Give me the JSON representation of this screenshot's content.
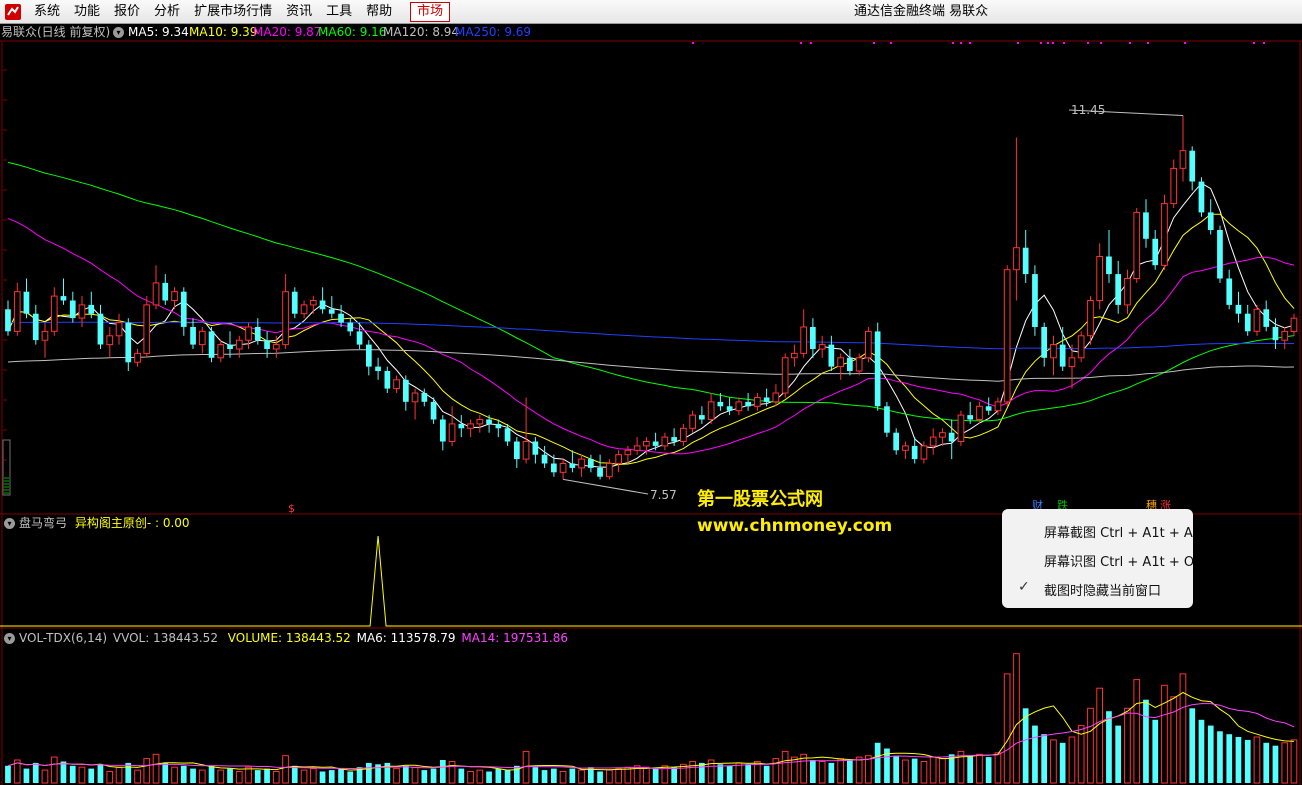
{
  "menubar": {
    "items": [
      "系统",
      "功能",
      "报价",
      "分析",
      "扩展市场行情",
      "资讯",
      "工具",
      "帮助"
    ],
    "market_tab": "市场",
    "app_title": "通达信金融终端  易联众"
  },
  "main_chart": {
    "stock_name": "易联众(日线 前复权)",
    "indicators": [
      {
        "label": "MA5: 9.34",
        "color": "#ffffff"
      },
      {
        "label": "MA10: 9.39",
        "color": "#ffff00"
      },
      {
        "label": "MA20: 9.87",
        "color": "#ff00ff"
      },
      {
        "label": "MA60: 9.16",
        "color": "#00ff00"
      },
      {
        "label": "MA120: 8.94",
        "color": "#c0c0c0"
      },
      {
        "label": "MA250: 9.69",
        "color": "#2040ff"
      }
    ],
    "high_label": "11.45",
    "low_label": "7.57",
    "dollar_marker": "$",
    "markers": [
      "财",
      "跌",
      "穗",
      "涨"
    ]
  },
  "sub_panel": {
    "name": "盘马弯弓",
    "formula": "异构阁主原创- : 0.00"
  },
  "vol_panel": {
    "name": "VOL-TDX(6,14)",
    "values": [
      {
        "label": "VVOL: 138443.52",
        "color": "#c0c0c0"
      },
      {
        "label": "VOLUME: 138443.52",
        "color": "#ffff00"
      },
      {
        "label": "MA6: 113578.79",
        "color": "#ffffff"
      },
      {
        "label": "MA14: 197531.86",
        "color": "#ff40ff"
      }
    ]
  },
  "watermark": {
    "line1": "第一股票公式网",
    "line2": "www.chnmoney.com"
  },
  "context_menu": {
    "items": [
      "屏幕截图 Ctrl + A1t + A",
      "屏幕识图 Ctrl + A1t + O",
      "截图时隐藏当前窗口"
    ],
    "check_mark": "✓"
  },
  "colors": {
    "up": "#ff3232",
    "down": "#54ffff",
    "background": "#000000",
    "grid": "#800000"
  },
  "chart_data": {
    "type": "candlestick",
    "ohlc": [
      [
        9.5,
        9.6,
        9.2,
        9.25
      ],
      [
        9.25,
        9.8,
        9.2,
        9.7
      ],
      [
        9.7,
        9.85,
        9.4,
        9.45
      ],
      [
        9.45,
        9.55,
        9.1,
        9.15
      ],
      [
        9.15,
        9.35,
        8.95,
        9.25
      ],
      [
        9.25,
        9.75,
        9.2,
        9.65
      ],
      [
        9.65,
        9.85,
        9.55,
        9.6
      ],
      [
        9.6,
        9.7,
        9.35,
        9.4
      ],
      [
        9.4,
        9.65,
        9.3,
        9.55
      ],
      [
        9.55,
        9.7,
        9.4,
        9.45
      ],
      [
        9.45,
        9.55,
        9.05,
        9.1
      ],
      [
        9.1,
        9.3,
        8.95,
        9.2
      ],
      [
        9.2,
        9.45,
        9.1,
        9.35
      ],
      [
        9.35,
        9.4,
        8.8,
        8.9
      ],
      [
        8.9,
        9.05,
        8.85,
        9.0
      ],
      [
        9.0,
        9.65,
        8.95,
        9.55
      ],
      [
        9.55,
        10.0,
        9.5,
        9.8
      ],
      [
        9.8,
        9.9,
        9.55,
        9.6
      ],
      [
        9.6,
        9.75,
        9.5,
        9.7
      ],
      [
        9.7,
        9.75,
        9.2,
        9.3
      ],
      [
        9.3,
        9.4,
        9.05,
        9.1
      ],
      [
        9.1,
        9.3,
        9.0,
        9.25
      ],
      [
        9.25,
        9.3,
        8.9,
        8.95
      ],
      [
        8.95,
        9.15,
        8.9,
        9.1
      ],
      [
        9.1,
        9.25,
        8.95,
        9.05
      ],
      [
        9.05,
        9.2,
        8.95,
        9.15
      ],
      [
        9.15,
        9.35,
        9.05,
        9.3
      ],
      [
        9.3,
        9.4,
        9.1,
        9.15
      ],
      [
        9.15,
        9.25,
        8.95,
        9.05
      ],
      [
        9.05,
        9.2,
        8.95,
        9.1
      ],
      [
        9.1,
        9.9,
        9.05,
        9.7
      ],
      [
        9.7,
        9.75,
        9.4,
        9.45
      ],
      [
        9.45,
        9.6,
        9.4,
        9.55
      ],
      [
        9.55,
        9.65,
        9.45,
        9.6
      ],
      [
        9.6,
        9.75,
        9.45,
        9.5
      ],
      [
        9.5,
        9.65,
        9.4,
        9.45
      ],
      [
        9.45,
        9.55,
        9.3,
        9.35
      ],
      [
        9.35,
        9.4,
        9.2,
        9.25
      ],
      [
        9.25,
        9.35,
        9.05,
        9.1
      ],
      [
        9.1,
        9.15,
        8.75,
        8.85
      ],
      [
        8.85,
        8.95,
        8.7,
        8.8
      ],
      [
        8.8,
        8.85,
        8.55,
        8.6
      ],
      [
        8.6,
        8.75,
        8.55,
        8.7
      ],
      [
        8.7,
        8.75,
        8.35,
        8.45
      ],
      [
        8.45,
        8.6,
        8.25,
        8.55
      ],
      [
        8.55,
        8.6,
        8.4,
        8.45
      ],
      [
        8.45,
        8.5,
        8.2,
        8.25
      ],
      [
        8.25,
        8.3,
        7.9,
        8.0
      ],
      [
        8.0,
        8.4,
        7.95,
        8.2
      ],
      [
        8.2,
        8.3,
        8.05,
        8.15
      ],
      [
        8.15,
        8.25,
        8.05,
        8.2
      ],
      [
        8.2,
        8.3,
        8.1,
        8.25
      ],
      [
        8.25,
        8.3,
        8.1,
        8.2
      ],
      [
        8.2,
        8.25,
        8.05,
        8.15
      ],
      [
        8.15,
        8.2,
        7.95,
        8.0
      ],
      [
        8.0,
        8.05,
        7.7,
        7.8
      ],
      [
        7.8,
        8.5,
        7.75,
        8.0
      ],
      [
        8.0,
        8.05,
        7.75,
        7.85
      ],
      [
        7.85,
        7.95,
        7.7,
        7.75
      ],
      [
        7.75,
        7.85,
        7.6,
        7.65
      ],
      [
        7.65,
        7.8,
        7.57,
        7.75
      ],
      [
        7.75,
        7.9,
        7.65,
        7.7
      ],
      [
        7.7,
        7.85,
        7.6,
        7.8
      ],
      [
        7.8,
        7.85,
        7.65,
        7.7
      ],
      [
        7.7,
        7.85,
        7.57,
        7.6
      ],
      [
        7.6,
        7.8,
        7.57,
        7.75
      ],
      [
        7.75,
        7.9,
        7.65,
        7.85
      ],
      [
        7.85,
        7.95,
        7.75,
        7.9
      ],
      [
        7.9,
        8.05,
        7.85,
        7.95
      ],
      [
        7.95,
        8.05,
        7.85,
        8.0
      ],
      [
        8.0,
        8.1,
        7.9,
        7.95
      ],
      [
        7.95,
        8.1,
        7.9,
        8.05
      ],
      [
        8.05,
        8.15,
        7.95,
        8.0
      ],
      [
        8.0,
        8.2,
        7.95,
        8.15
      ],
      [
        8.15,
        8.35,
        8.1,
        8.3
      ],
      [
        8.3,
        8.4,
        8.2,
        8.25
      ],
      [
        8.25,
        8.55,
        8.2,
        8.45
      ],
      [
        8.45,
        8.55,
        8.35,
        8.4
      ],
      [
        8.4,
        8.5,
        8.3,
        8.35
      ],
      [
        8.35,
        8.5,
        8.3,
        8.45
      ],
      [
        8.45,
        8.55,
        8.35,
        8.4
      ],
      [
        8.4,
        8.55,
        8.35,
        8.5
      ],
      [
        8.5,
        8.6,
        8.4,
        8.45
      ],
      [
        8.45,
        8.65,
        8.4,
        8.55
      ],
      [
        8.55,
        9.0,
        8.5,
        8.95
      ],
      [
        8.95,
        9.1,
        8.85,
        9.0
      ],
      [
        9.0,
        9.5,
        8.95,
        9.3
      ],
      [
        9.3,
        9.4,
        8.95,
        9.05
      ],
      [
        9.05,
        9.2,
        8.95,
        9.1
      ],
      [
        9.1,
        9.2,
        8.8,
        8.85
      ],
      [
        8.85,
        9.0,
        8.7,
        8.95
      ],
      [
        8.95,
        9.05,
        8.75,
        8.8
      ],
      [
        8.8,
        9.0,
        8.75,
        8.95
      ],
      [
        8.95,
        9.3,
        8.9,
        9.25
      ],
      [
        9.25,
        9.35,
        8.35,
        8.4
      ],
      [
        8.4,
        8.45,
        8.05,
        8.1
      ],
      [
        8.1,
        8.15,
        7.85,
        7.9
      ],
      [
        7.9,
        8.0,
        7.8,
        7.95
      ],
      [
        7.95,
        8.05,
        7.75,
        7.8
      ],
      [
        7.8,
        8.0,
        7.75,
        7.95
      ],
      [
        7.95,
        8.15,
        7.85,
        8.05
      ],
      [
        8.05,
        8.15,
        7.95,
        8.1
      ],
      [
        8.1,
        8.25,
        7.8,
        8.0
      ],
      [
        8.0,
        8.35,
        7.95,
        8.3
      ],
      [
        8.3,
        8.45,
        8.2,
        8.25
      ],
      [
        8.25,
        8.45,
        8.2,
        8.4
      ],
      [
        8.4,
        8.5,
        8.3,
        8.35
      ],
      [
        8.35,
        8.5,
        8.3,
        8.45
      ],
      [
        8.45,
        10.0,
        8.4,
        9.95
      ],
      [
        9.95,
        11.45,
        9.6,
        10.2
      ],
      [
        10.2,
        10.4,
        9.8,
        9.9
      ],
      [
        9.9,
        10.0,
        9.2,
        9.3
      ],
      [
        9.3,
        9.35,
        8.85,
        8.95
      ],
      [
        8.95,
        9.2,
        8.75,
        9.1
      ],
      [
        9.1,
        9.3,
        8.8,
        8.85
      ],
      [
        8.85,
        9.1,
        8.6,
        8.95
      ],
      [
        8.95,
        9.25,
        8.9,
        9.2
      ],
      [
        9.2,
        9.65,
        9.1,
        9.6
      ],
      [
        9.6,
        10.25,
        9.5,
        10.1
      ],
      [
        10.1,
        10.4,
        9.8,
        9.9
      ],
      [
        9.9,
        10.05,
        9.45,
        9.55
      ],
      [
        9.55,
        9.95,
        9.45,
        9.85
      ],
      [
        9.85,
        10.65,
        9.8,
        10.6
      ],
      [
        10.6,
        10.75,
        10.2,
        10.3
      ],
      [
        10.3,
        10.4,
        9.95,
        10.0
      ],
      [
        10.0,
        10.8,
        9.95,
        10.7
      ],
      [
        10.7,
        11.2,
        10.65,
        11.1
      ],
      [
        11.1,
        11.7,
        10.95,
        11.3
      ],
      [
        11.3,
        11.35,
        10.85,
        10.95
      ],
      [
        10.95,
        11.0,
        10.55,
        10.6
      ],
      [
        10.6,
        10.75,
        10.35,
        10.4
      ],
      [
        10.4,
        10.45,
        9.8,
        9.85
      ],
      [
        9.85,
        9.95,
        9.5,
        9.55
      ],
      [
        9.55,
        9.7,
        9.35,
        9.45
      ],
      [
        9.45,
        9.55,
        9.2,
        9.25
      ],
      [
        9.25,
        9.55,
        9.2,
        9.5
      ],
      [
        9.5,
        9.6,
        9.25,
        9.3
      ],
      [
        9.3,
        9.4,
        9.05,
        9.15
      ],
      [
        9.15,
        9.3,
        9.05,
        9.25
      ],
      [
        9.25,
        9.45,
        9.2,
        9.4
      ]
    ],
    "volume": [
      60,
      80,
      50,
      70,
      45,
      90,
      75,
      60,
      55,
      50,
      65,
      40,
      55,
      70,
      45,
      85,
      100,
      70,
      55,
      60,
      50,
      45,
      60,
      45,
      50,
      40,
      55,
      45,
      50,
      40,
      95,
      60,
      45,
      50,
      40,
      45,
      50,
      40,
      55,
      70,
      65,
      70,
      50,
      60,
      55,
      45,
      50,
      80,
      75,
      50,
      40,
      45,
      40,
      50,
      45,
      60,
      110,
      55,
      45,
      50,
      40,
      50,
      45,
      55,
      40,
      45,
      50,
      55,
      60,
      55,
      50,
      60,
      55,
      65,
      75,
      70,
      80,
      65,
      60,
      70,
      65,
      75,
      60,
      85,
      110,
      90,
      100,
      80,
      75,
      70,
      85,
      80,
      90,
      95,
      140,
      120,
      95,
      80,
      85,
      75,
      90,
      85,
      100,
      110,
      95,
      100,
      90,
      105,
      380,
      450,
      260,
      200,
      170,
      150,
      140,
      160,
      200,
      260,
      330,
      250,
      200,
      260,
      360,
      290,
      220,
      340,
      300,
      380,
      260,
      220,
      200,
      180,
      170,
      160,
      150,
      160,
      140,
      130,
      140,
      150
    ],
    "sub_signal": {
      "spike_index": 40,
      "value": 1
    }
  }
}
